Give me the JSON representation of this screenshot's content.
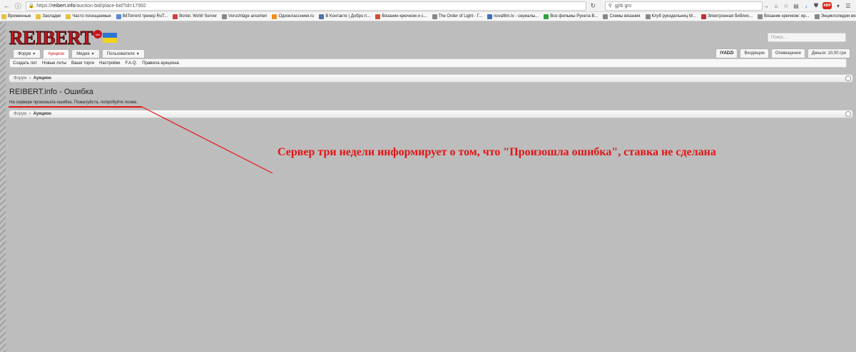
{
  "browser": {
    "url_prefix": "https://",
    "url_host": "reibert.info",
    "url_path": "/auction-bid/place-bid?id=17992",
    "search_value": "gjrb grv",
    "bookmarks": [
      {
        "label": "Временные",
        "color": "#e8c040"
      },
      {
        "label": "Закладки",
        "color": "#e8c040"
      },
      {
        "label": "Часто посещаемые",
        "color": "#e8c040"
      },
      {
        "label": "BitTorrent трекер RuT...",
        "color": "#5a8ad0"
      },
      {
        "label": "Bortel. WoW Server",
        "color": "#d04040"
      },
      {
        "label": "Vorschläge ansehen",
        "color": "#888888"
      },
      {
        "label": "Одноклассники.ru",
        "color": "#f09020"
      },
      {
        "label": "В Контакте | Добро п...",
        "color": "#4a76a8"
      },
      {
        "label": "Вязание крючком и с...",
        "color": "#d05030"
      },
      {
        "label": "The Order of Light - Г...",
        "color": "#888888"
      },
      {
        "label": "novafilm.tv - сериалы...",
        "color": "#4070c0"
      },
      {
        "label": "Все фильмы Рунета В...",
        "color": "#30a040"
      },
      {
        "label": "Схемы вязания",
        "color": "#888888"
      },
      {
        "label": "Клуб рукодельниц М...",
        "color": "#888888"
      },
      {
        "label": "Электронная библио...",
        "color": "#c03030"
      },
      {
        "label": "Вязание крючком: ир...",
        "color": "#888888"
      },
      {
        "label": "Энциклопедии вязани...",
        "color": "#888888"
      },
      {
        "label": "Ирландское кружево ...",
        "color": "#888888"
      }
    ]
  },
  "site": {
    "logo": "REIBERT",
    "logo_badge": "info",
    "search_placeholder": "Поиск...",
    "tabs": [
      {
        "label": "Форум",
        "caret": true,
        "active": false
      },
      {
        "label": "Аукцион",
        "caret": false,
        "active": true
      },
      {
        "label": "Медиа",
        "caret": true,
        "active": false
      },
      {
        "label": "Пользователи",
        "caret": true,
        "active": false
      }
    ],
    "user": {
      "name": "IYADZI",
      "inbox": "Входящие",
      "alerts": "Оповещения",
      "money": "Деньги: 10,00 грн"
    },
    "subnav": [
      "Создать лот",
      "Новые лоты",
      "Ваши торги",
      "Настройки",
      "F.A.Q.",
      "Правила аукциона"
    ],
    "breadcrumb": {
      "root": "Форум",
      "sep": "»",
      "current": "Аукцион"
    },
    "page_title": "REIBERT.info - Ошибка",
    "error_message": "На сервере произошла ошибка. Пожалуйста, попробуйте позже."
  },
  "annotation": {
    "text": "Сервер три недели информирует о том, что \"Произошла ошибка\", ставка не сделана",
    "color": "#e41414"
  }
}
